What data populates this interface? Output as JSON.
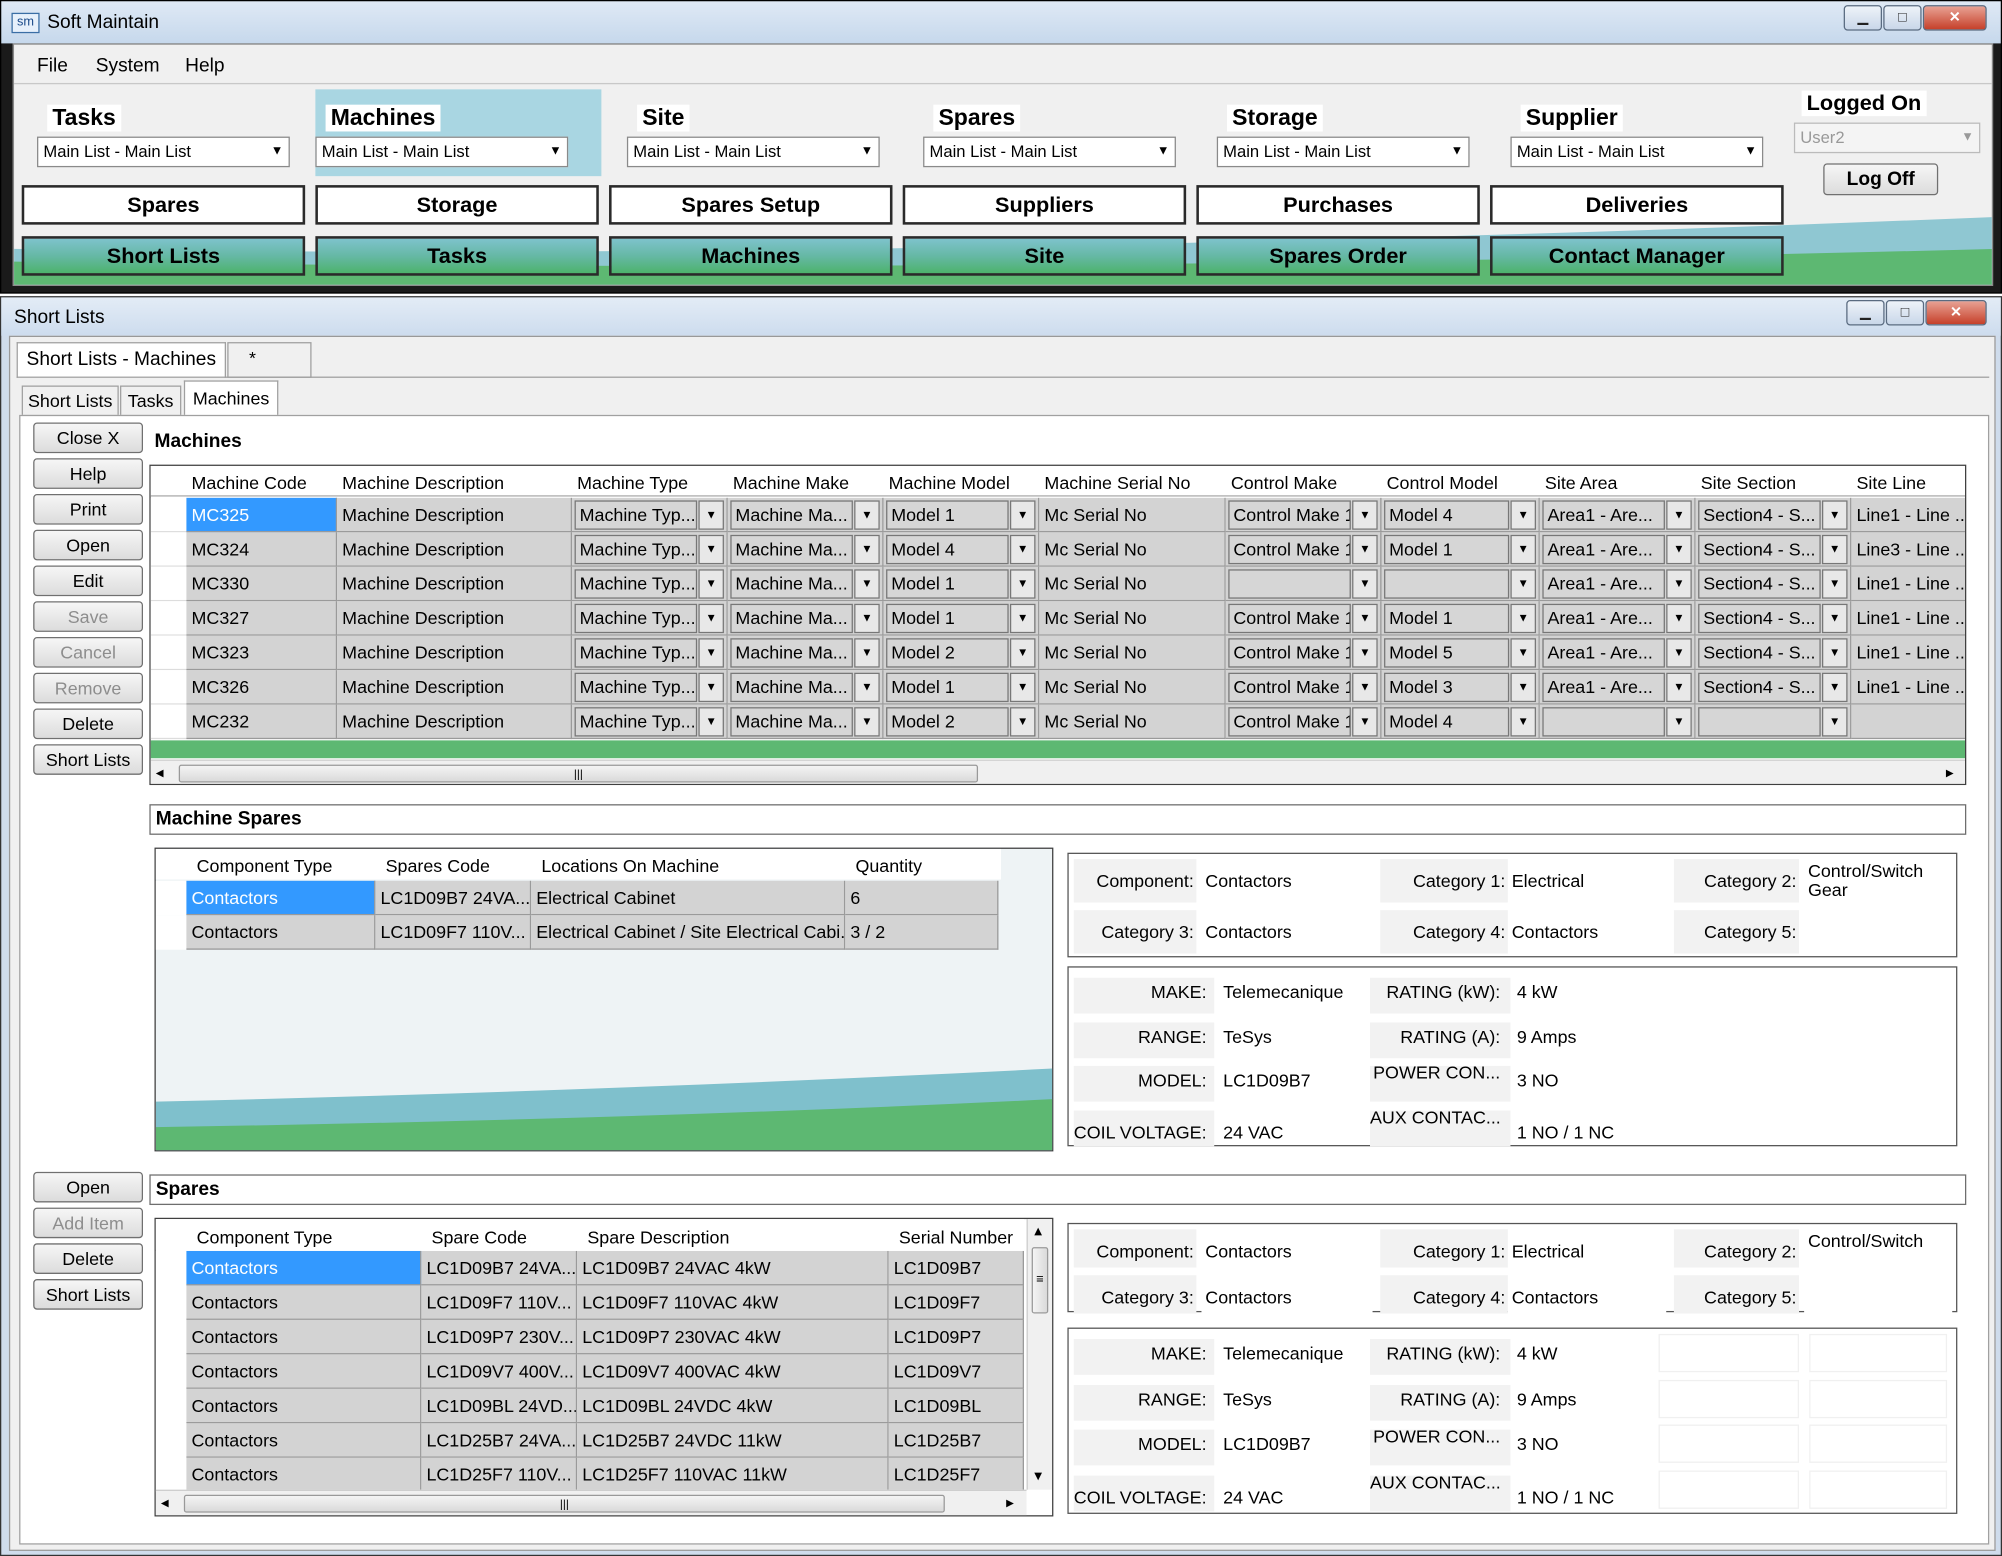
{
  "app": {
    "title": "Soft Maintain",
    "icon_text": "sm"
  },
  "menu": [
    "File",
    "System",
    "Help"
  ],
  "modules": [
    {
      "name": "Tasks",
      "value": "Main List - Main List"
    },
    {
      "name": "Machines",
      "value": "Main List - Main List"
    },
    {
      "name": "Site",
      "value": "Main List - Main List"
    },
    {
      "name": "Spares",
      "value": "Main List - Main List"
    },
    {
      "name": "Storage",
      "value": "Main List  - Main List"
    },
    {
      "name": "Supplier",
      "value": "Main List - Main List"
    }
  ],
  "logon": {
    "title": "Logged On",
    "user": "User2",
    "logoff": "Log Off"
  },
  "nav_row1": [
    "Spares",
    "Storage",
    "Spares Setup",
    "Suppliers",
    "Purchases",
    "Deliveries"
  ],
  "nav_row2": [
    "Short Lists",
    "Tasks",
    "Machines",
    "Site",
    "Spares Order",
    "Contact Manager"
  ],
  "child": {
    "title": "Short Lists",
    "doc_tab": "Short Lists - Machines",
    "doc_tab2": "*",
    "tabs": [
      "Short Lists",
      "Tasks",
      "Machines"
    ]
  },
  "side_buttons": [
    "Close X",
    "Help",
    "Print",
    "Open",
    "Edit",
    "Save",
    "Cancel",
    "Remove",
    "Delete",
    "Short Lists"
  ],
  "side_buttons2": [
    "Open",
    "Add Item",
    "Delete",
    "Short Lists"
  ],
  "machines": {
    "title": "Machines",
    "columns": [
      "Machine Code",
      "Machine Description",
      "Machine Type",
      "Machine Make",
      "Machine Model",
      "Machine Serial No",
      "Control Make",
      "Control Model",
      "Site Area",
      "Site Section",
      "Site Line"
    ],
    "rows": [
      [
        "MC325",
        "Machine Description",
        "Machine Typ...",
        "Machine Ma...",
        "Model 1",
        "Mc Serial No",
        "Control Make 1",
        "Model 4",
        "Area1  -  Are...",
        "Section4  -  S...",
        "Line1  -  Line ..."
      ],
      [
        "MC324",
        "Machine Description",
        "Machine Typ...",
        "Machine Ma...",
        "Model 4",
        "Mc Serial No",
        "Control Make 1",
        "Model 1",
        "Area1  -  Are...",
        "Section4  -  S...",
        "Line3  -  Line ..."
      ],
      [
        "MC330",
        "Machine Description",
        "Machine Typ...",
        "Machine Ma...",
        "Model 1",
        "Mc Serial No",
        "",
        "",
        "Area1  -  Are...",
        "Section4  -  S...",
        "Line1  -  Line ..."
      ],
      [
        "MC327",
        "Machine Description",
        "Machine Typ...",
        "Machine Ma...",
        "Model 1",
        "Mc Serial No",
        "Control Make 1",
        "Model 1",
        "Area1  -  Are...",
        "Section4  -  S...",
        "Line1  -  Line ..."
      ],
      [
        "MC323",
        "Machine Description",
        "Machine Typ...",
        "Machine Ma...",
        "Model 2",
        "Mc Serial No",
        "Control Make 1",
        "Model 5",
        "Area1  -  Are...",
        "Section4  -  S...",
        "Line1  -  Line ..."
      ],
      [
        "MC326",
        "Machine Description",
        "Machine Typ...",
        "Machine Ma...",
        "Model 1",
        "Mc Serial No",
        "Control Make 1",
        "Model 3",
        "Area1  -  Are...",
        "Section4  -  S...",
        "Line1  -  Line ..."
      ],
      [
        "MC232",
        "Machine Description",
        "Machine Typ...",
        "Machine Ma...",
        "Model 2",
        "Mc Serial No",
        "Control Make 1",
        "Model 4",
        "",
        "",
        ""
      ]
    ]
  },
  "machine_spares": {
    "title": "Machine Spares",
    "columns": [
      "Component Type",
      "Spares Code",
      "Locations On Machine",
      "Quantity"
    ],
    "rows": [
      [
        "Contactors",
        "LC1D09B7 24VA...",
        "Electrical Cabinet",
        "6"
      ],
      [
        "Contactors",
        "LC1D09F7 110V...",
        "Electrical Cabinet / Site Electrical Cabi...",
        "3 / 2"
      ]
    ]
  },
  "info1": {
    "cat": {
      "component_l": "Component:",
      "component": "Contactors",
      "cat1_l": "Category 1:",
      "cat1": "Electrical",
      "cat2_l": "Category 2:",
      "cat2": "Control/Switch Gear",
      "cat3_l": "Category 3:",
      "cat3": "Contactors",
      "cat4_l": "Category 4:",
      "cat4": "Contactors",
      "cat5_l": "Category 5:",
      "cat5": ""
    },
    "spec": {
      "make_l": "MAKE:",
      "make": "Telemecanique",
      "range_l": "RANGE:",
      "range": "TeSys",
      "model_l": "MODEL:",
      "model": "LC1D09B7",
      "coil_l": "COIL VOLTAGE:",
      "coil": "24 VAC",
      "rkw_l": "RATING (kW):",
      "rkw": "4 kW",
      "ra_l": "RATING (A):",
      "ra": "9 Amps",
      "pc_l": "POWER CON...",
      "pc": "3 NO",
      "aux_l": "AUX CONTAC...",
      "aux": "1 NO / 1 NC"
    }
  },
  "spares": {
    "title": "Spares",
    "columns": [
      "Component Type",
      "Spare Code",
      "Spare Description",
      "Serial Number"
    ],
    "rows": [
      [
        "Contactors",
        "LC1D09B7 24VA...",
        "LC1D09B7 24VAC 4kW",
        "LC1D09B7"
      ],
      [
        "Contactors",
        "LC1D09F7 110V...",
        "LC1D09F7 110VAC 4kW",
        "LC1D09F7"
      ],
      [
        "Contactors",
        "LC1D09P7 230V...",
        "LC1D09P7 230VAC 4kW",
        "LC1D09P7"
      ],
      [
        "Contactors",
        "LC1D09V7 400V...",
        "LC1D09V7 400VAC 4kW",
        "LC1D09V7"
      ],
      [
        "Contactors",
        "LC1D09BL 24VD...",
        "LC1D09BL 24VDC 4kW",
        "LC1D09BL"
      ],
      [
        "Contactors",
        "LC1D25B7 24VA...",
        "LC1D25B7 24VDC 11kW",
        "LC1D25B7"
      ],
      [
        "Contactors",
        "LC1D25F7 110V...",
        "LC1D25F7 110VAC 11kW",
        "LC1D25F7"
      ]
    ]
  },
  "info2": {
    "cat": {
      "component_l": "Component:",
      "component": "Contactors",
      "cat1_l": "Category 1:",
      "cat1": "Electrical",
      "cat2_l": "Category 2:",
      "cat2": "Control/Switch",
      "cat3_l": "Category 3:",
      "cat3": "Contactors",
      "cat4_l": "Category 4:",
      "cat4": "Contactors",
      "cat5_l": "Category 5:",
      "cat5": ""
    },
    "spec": {
      "make_l": "MAKE:",
      "make": "Telemecanique",
      "range_l": "RANGE:",
      "range": "TeSys",
      "model_l": "MODEL:",
      "model": "LC1D09B7",
      "coil_l": "COIL VOLTAGE:",
      "coil": "24 VAC",
      "rkw_l": "RATING (kW):",
      "rkw": "4 kW",
      "ra_l": "RATING (A):",
      "ra": "9 Amps",
      "pc_l": "POWER CON...",
      "pc": "3 NO",
      "aux_l": "AUX CONTAC...",
      "aux": "1 NO / 1 NC"
    }
  },
  "glyphs": {
    "minimize": "▁",
    "maximize": "□",
    "close": "✕",
    "dropdown": "▼",
    "scroll_left": "◂",
    "scroll_right": "▸",
    "scroll_up": "▴",
    "scroll_down": "▾",
    "grip": "|||",
    "grip_v": "≡"
  }
}
